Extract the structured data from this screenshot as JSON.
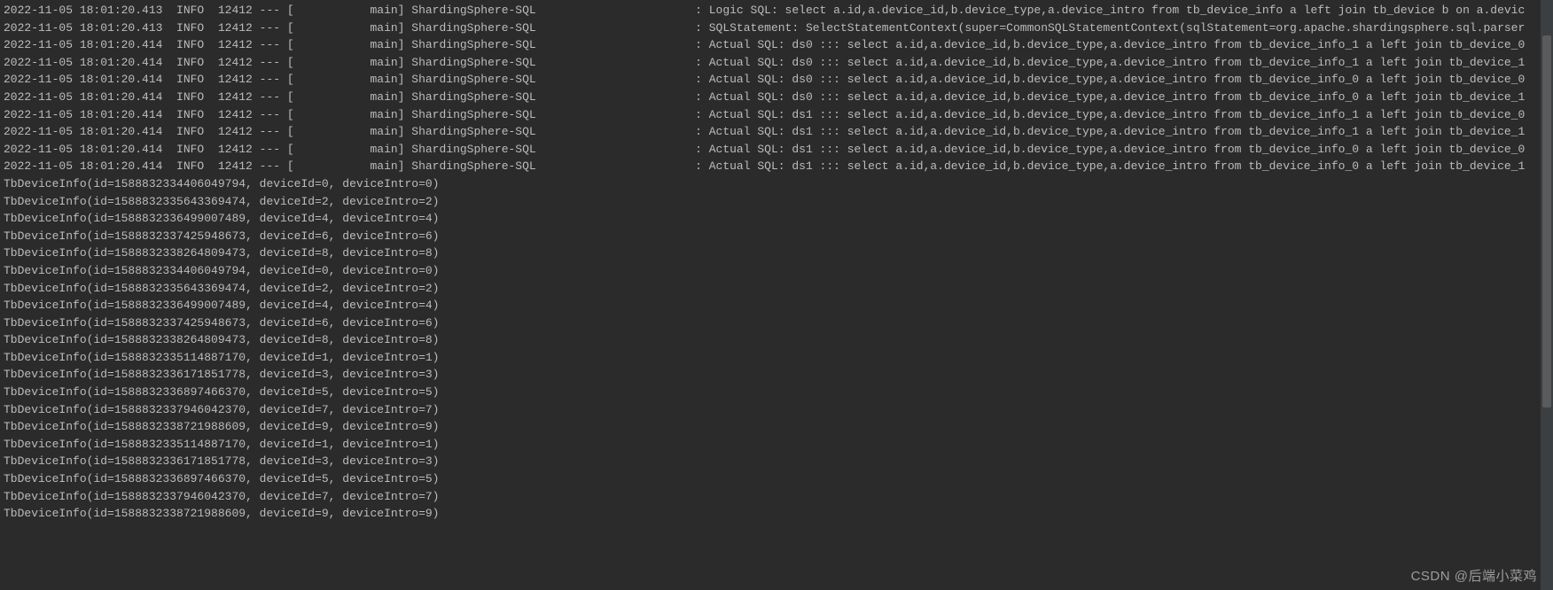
{
  "log": {
    "sqlLines": [
      {
        "ts": "2022-11-05 18:01:20.413",
        "level": "INFO",
        "pid": "12412",
        "thread": "main",
        "logger": "ShardingSphere-SQL",
        "msg": "Logic SQL: select a.id,a.device_id,b.device_type,a.device_intro from tb_device_info a left join tb_device b on a.devic"
      },
      {
        "ts": "2022-11-05 18:01:20.413",
        "level": "INFO",
        "pid": "12412",
        "thread": "main",
        "logger": "ShardingSphere-SQL",
        "msg": "SQLStatement: SelectStatementContext(super=CommonSQLStatementContext(sqlStatement=org.apache.shardingsphere.sql.parser"
      },
      {
        "ts": "2022-11-05 18:01:20.414",
        "level": "INFO",
        "pid": "12412",
        "thread": "main",
        "logger": "ShardingSphere-SQL",
        "msg": "Actual SQL: ds0 ::: select a.id,a.device_id,b.device_type,a.device_intro from tb_device_info_1 a left join tb_device_0"
      },
      {
        "ts": "2022-11-05 18:01:20.414",
        "level": "INFO",
        "pid": "12412",
        "thread": "main",
        "logger": "ShardingSphere-SQL",
        "msg": "Actual SQL: ds0 ::: select a.id,a.device_id,b.device_type,a.device_intro from tb_device_info_1 a left join tb_device_1"
      },
      {
        "ts": "2022-11-05 18:01:20.414",
        "level": "INFO",
        "pid": "12412",
        "thread": "main",
        "logger": "ShardingSphere-SQL",
        "msg": "Actual SQL: ds0 ::: select a.id,a.device_id,b.device_type,a.device_intro from tb_device_info_0 a left join tb_device_0"
      },
      {
        "ts": "2022-11-05 18:01:20.414",
        "level": "INFO",
        "pid": "12412",
        "thread": "main",
        "logger": "ShardingSphere-SQL",
        "msg": "Actual SQL: ds0 ::: select a.id,a.device_id,b.device_type,a.device_intro from tb_device_info_0 a left join tb_device_1"
      },
      {
        "ts": "2022-11-05 18:01:20.414",
        "level": "INFO",
        "pid": "12412",
        "thread": "main",
        "logger": "ShardingSphere-SQL",
        "msg": "Actual SQL: ds1 ::: select a.id,a.device_id,b.device_type,a.device_intro from tb_device_info_1 a left join tb_device_0"
      },
      {
        "ts": "2022-11-05 18:01:20.414",
        "level": "INFO",
        "pid": "12412",
        "thread": "main",
        "logger": "ShardingSphere-SQL",
        "msg": "Actual SQL: ds1 ::: select a.id,a.device_id,b.device_type,a.device_intro from tb_device_info_1 a left join tb_device_1"
      },
      {
        "ts": "2022-11-05 18:01:20.414",
        "level": "INFO",
        "pid": "12412",
        "thread": "main",
        "logger": "ShardingSphere-SQL",
        "msg": "Actual SQL: ds1 ::: select a.id,a.device_id,b.device_type,a.device_intro from tb_device_info_0 a left join tb_device_0"
      },
      {
        "ts": "2022-11-05 18:01:20.414",
        "level": "INFO",
        "pid": "12412",
        "thread": "main",
        "logger": "ShardingSphere-SQL",
        "msg": "Actual SQL: ds1 ::: select a.id,a.device_id,b.device_type,a.device_intro from tb_device_info_0 a left join tb_device_1"
      }
    ],
    "objLines": [
      "TbDeviceInfo(id=1588832334406049794, deviceId=0, deviceIntro=0)",
      "TbDeviceInfo(id=1588832335643369474, deviceId=2, deviceIntro=2)",
      "TbDeviceInfo(id=1588832336499007489, deviceId=4, deviceIntro=4)",
      "TbDeviceInfo(id=1588832337425948673, deviceId=6, deviceIntro=6)",
      "TbDeviceInfo(id=1588832338264809473, deviceId=8, deviceIntro=8)",
      "TbDeviceInfo(id=1588832334406049794, deviceId=0, deviceIntro=0)",
      "TbDeviceInfo(id=1588832335643369474, deviceId=2, deviceIntro=2)",
      "TbDeviceInfo(id=1588832336499007489, deviceId=4, deviceIntro=4)",
      "TbDeviceInfo(id=1588832337425948673, deviceId=6, deviceIntro=6)",
      "TbDeviceInfo(id=1588832338264809473, deviceId=8, deviceIntro=8)",
      "TbDeviceInfo(id=1588832335114887170, deviceId=1, deviceIntro=1)",
      "TbDeviceInfo(id=1588832336171851778, deviceId=3, deviceIntro=3)",
      "TbDeviceInfo(id=1588832336897466370, deviceId=5, deviceIntro=5)",
      "TbDeviceInfo(id=1588832337946042370, deviceId=7, deviceIntro=7)",
      "TbDeviceInfo(id=1588832338721988609, deviceId=9, deviceIntro=9)",
      "TbDeviceInfo(id=1588832335114887170, deviceId=1, deviceIntro=1)",
      "TbDeviceInfo(id=1588832336171851778, deviceId=3, deviceIntro=3)",
      "TbDeviceInfo(id=1588832336897466370, deviceId=5, deviceIntro=5)",
      "TbDeviceInfo(id=1588832337946042370, deviceId=7, deviceIntro=7)",
      "TbDeviceInfo(id=1588832338721988609, deviceId=9, deviceIntro=9)"
    ]
  },
  "watermark": "CSDN @后端小菜鸡"
}
